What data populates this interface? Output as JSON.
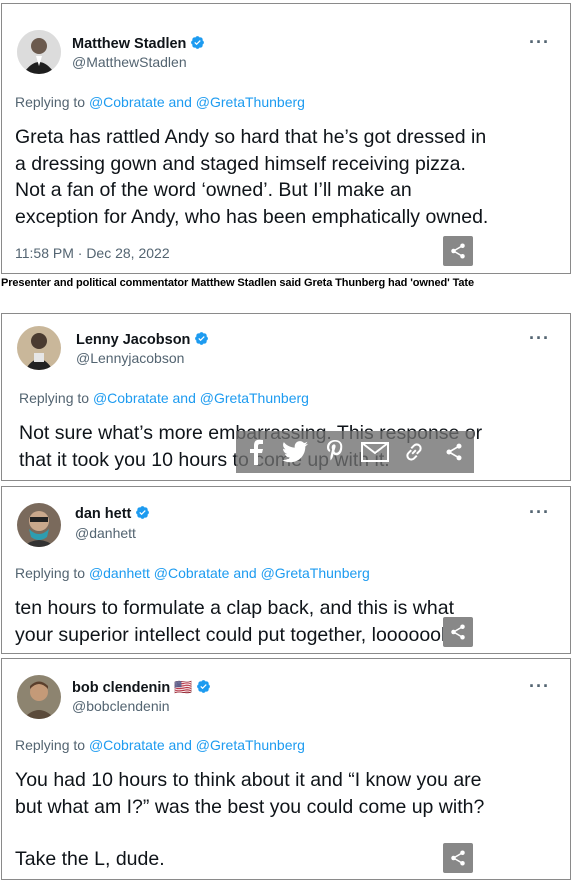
{
  "tweets": [
    {
      "name": "Matthew Stadlen",
      "handle": "@MatthewStadlen",
      "reply_prefix": "Replying to ",
      "reply_to": "@Cobratate and @GretaThunberg",
      "lines": [
        "Greta has rattled Andy so hard that he’s got dressed in",
        "a dressing gown and staged himself receiving pizza.",
        "Not a fan of the word ‘owned’. But I’ll make an",
        "exception for Andy, who has been emphatically owned."
      ],
      "timestamp": "11:58 PM · Dec 28, 2022"
    },
    {
      "name": "Lenny Jacobson",
      "handle": "@Lennyjacobson",
      "reply_prefix": "Replying to ",
      "reply_to": "@Cobratate and @GretaThunberg",
      "lines": [
        "Not sure what’s more embarrassing. This response or",
        "that it took you 10 hours to come up with it."
      ]
    },
    {
      "name": "dan hett",
      "handle": "@danhett",
      "reply_prefix": "Replying to ",
      "reply_to": "@danhett @Cobratate and @GretaThunberg",
      "lines": [
        "ten hours to formulate a clap back, and this is what",
        "your superior intellect could put together, looooool"
      ]
    },
    {
      "name": "bob clendenin",
      "flag": "🇺🇸",
      "handle": "@bobclendenin",
      "reply_prefix": "Replying to ",
      "reply_to": "@Cobratate and @GretaThunberg",
      "lines": [
        "You had 10 hours to think about it and “I know you are",
        "but what am I?” was the best you could come up with?",
        "",
        "Take the L, dude."
      ]
    }
  ],
  "caption": "Presenter and political commentator Matthew Stadlen said Greta Thunberg had 'owned' Tate",
  "more_label": "···",
  "share_icons": [
    "facebook-icon",
    "twitter-icon",
    "pinterest-icon",
    "email-icon",
    "link-icon",
    "share-icon"
  ],
  "colors": {
    "verified": "#1d9bf0",
    "link": "#1d9bf0",
    "secondary_text": "#536471",
    "overlay": "#6e6e6e"
  }
}
